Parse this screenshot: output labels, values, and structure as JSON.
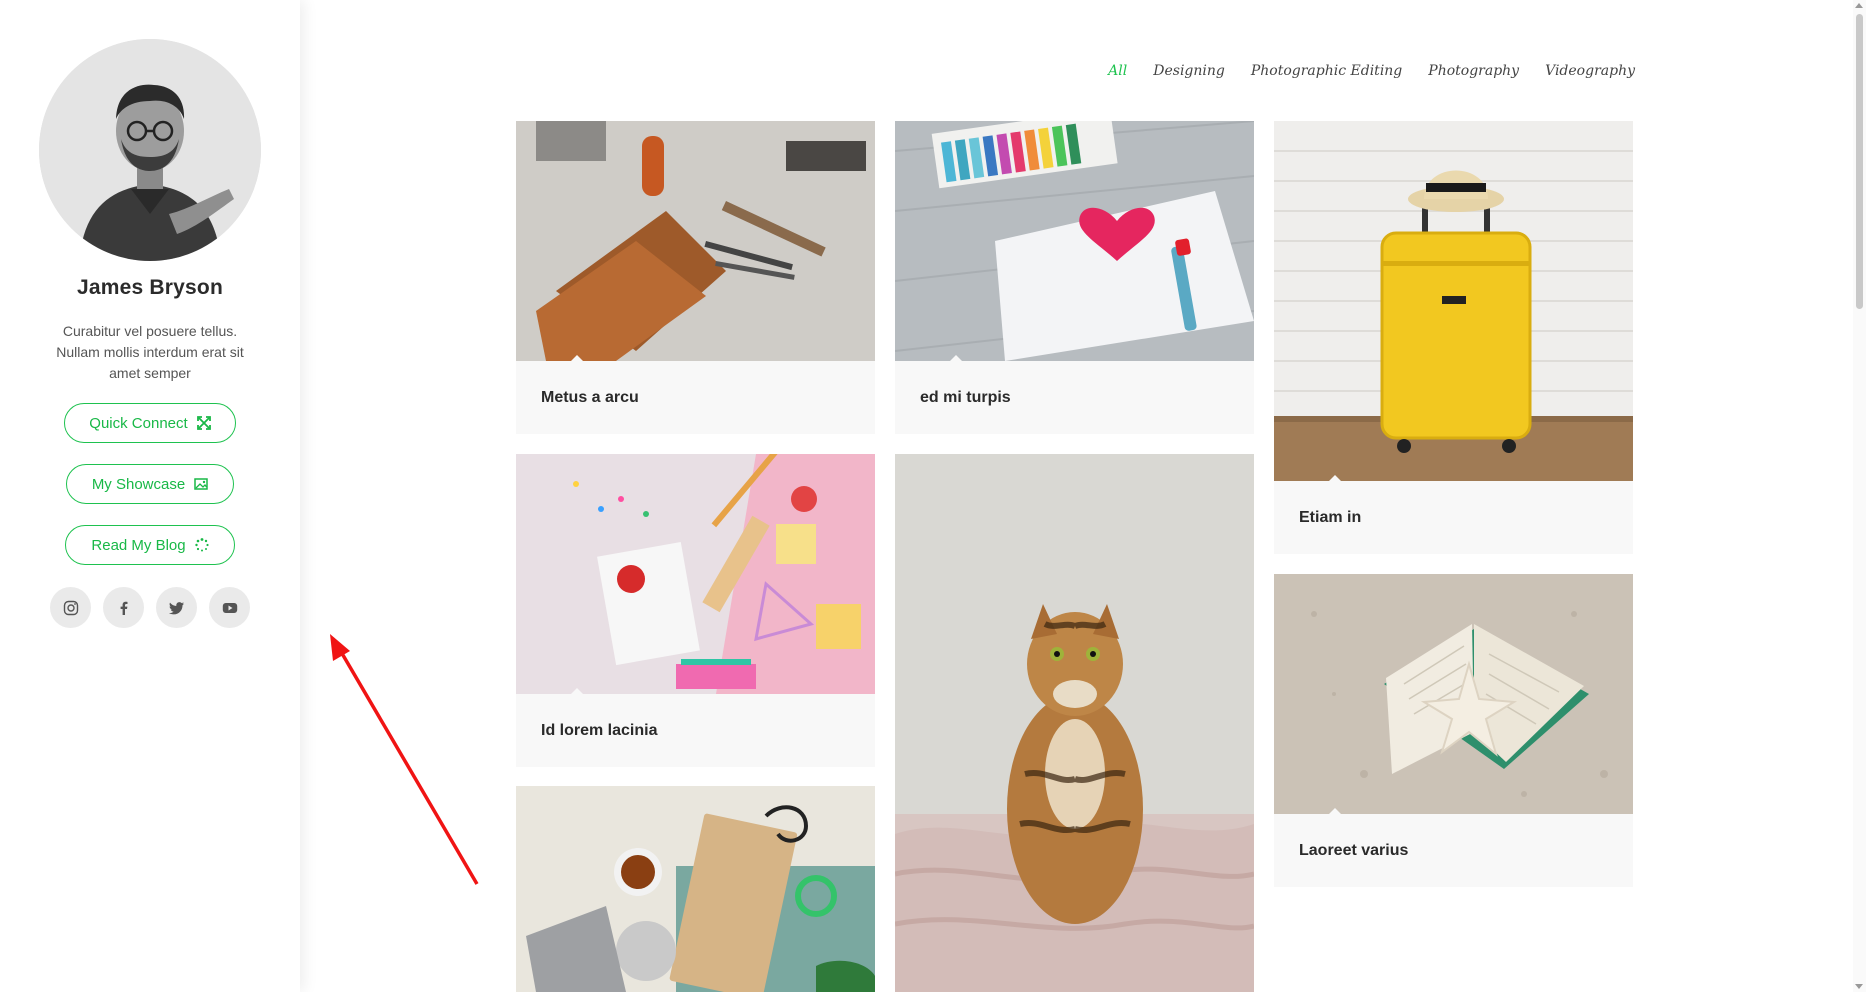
{
  "profile": {
    "name": "James Bryson",
    "bio": "Curabitur vel posuere tellus. Nullam mollis interdum erat sit amet semper"
  },
  "buttons": {
    "quick_connect": "Quick Connect",
    "showcase": "My Showcase",
    "blog": "Read My Blog"
  },
  "social": [
    "instagram-icon",
    "facebook-icon",
    "twitter-icon",
    "youtube-icon"
  ],
  "filters": [
    "All",
    "Designing",
    "Photographic Editing",
    "Photography",
    "Videography"
  ],
  "active_filter": "All",
  "gallery": [
    {
      "title": "Metus a arcu"
    },
    {
      "title": "ed mi turpis"
    },
    {
      "title": "Etiam in"
    },
    {
      "title": "Id lorem lacinia"
    },
    {
      "title": ""
    },
    {
      "title": "Laoreet varius"
    },
    {
      "title": ""
    }
  ],
  "colors": {
    "accent": "#1ec24f",
    "card_bg": "#f8f8f8",
    "annotation": "#f01414"
  }
}
